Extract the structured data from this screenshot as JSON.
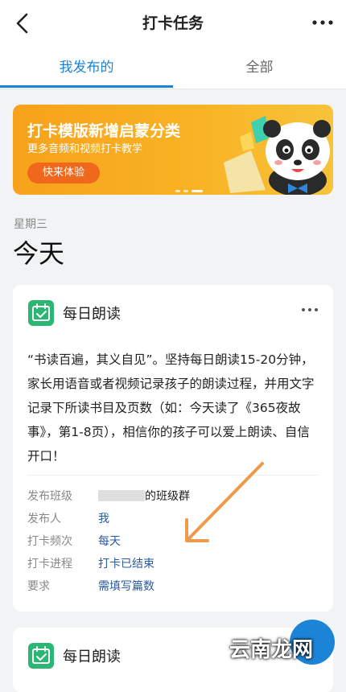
{
  "header": {
    "title": "打卡任务"
  },
  "tabs": [
    {
      "label": "我发布的",
      "active": true
    },
    {
      "label": "全部",
      "active": false
    }
  ],
  "banner": {
    "title": "打卡模版新增启蒙分类",
    "subtitle": "更多音频和视频打卡教学",
    "button_label": "快来体验",
    "pages": 3,
    "active_page": 3
  },
  "day": {
    "weekday": "星期三",
    "label": "今天"
  },
  "task": {
    "title": "每日朗读",
    "description": "“书读百遍，其义自见”。坚持每日朗读15-20分钟，家长用语音或者视频记录孩子的朗读过程，并用文字记录下所读书目及页数（如：今天读了《365夜故事》，第1-8页），相信你的孩子可以爱上朗读、自信开口！",
    "fields": [
      {
        "label": "发布班级",
        "value": "的班级群",
        "value_prefix_blurred": true
      },
      {
        "label": "发布人",
        "value": "我"
      },
      {
        "label": "打卡频次",
        "value": "每天"
      },
      {
        "label": "打卡进程",
        "value": "打卡已结束"
      },
      {
        "label": "要求",
        "value": "需填写篇数"
      }
    ]
  },
  "next_task": {
    "title": "每日朗读"
  },
  "watermark": {
    "text": "云南龙网"
  },
  "colors": {
    "accent": "#1c84d6",
    "icon_green": "#2bb673",
    "banner_orange": "#f7a21c",
    "annotation_arrow": "#ef9a4a"
  }
}
